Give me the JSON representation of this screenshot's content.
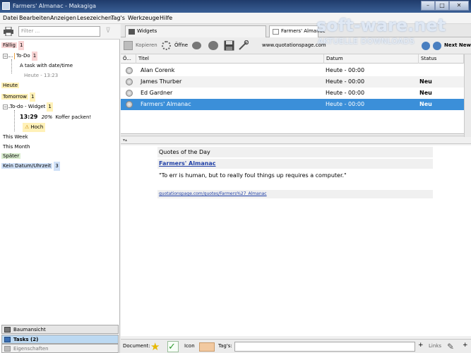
{
  "window": {
    "title": "Farmers' Almanac - Makagiga"
  },
  "menu": [
    "Datei",
    "Bearbeiten",
    "Anzeigen",
    "Lesezeichen",
    "Tag's",
    "Werkzeuge",
    "Hilfe"
  ],
  "watermark": {
    "line1": "soft-ware.net",
    "line2": "AKTUELLE DOWNLOADS"
  },
  "left": {
    "filter_placeholder": "Filter ...",
    "tree": {
      "faellig": {
        "label": "Fällig",
        "count": "1"
      },
      "todo_group": {
        "label": "To-Do",
        "count": "1"
      },
      "todo_task": {
        "title": "A task with date/time",
        "due": "Heute - 13:23"
      },
      "heute": {
        "label": "Heute"
      },
      "tomorrow": {
        "label": "Tomorrow",
        "count": "1"
      },
      "widget_group": {
        "label": "To-do - Widget",
        "count": "1"
      },
      "widget_task": {
        "time": "13:29",
        "percent": "20%",
        "title": "Koffer packen!",
        "priority": "Hoch"
      },
      "this_week": {
        "label": "This Week"
      },
      "this_month": {
        "label": "This Month"
      },
      "spaeter": {
        "label": "Später"
      },
      "kein_datum": {
        "label": "Kein Datum/Uhrzeit",
        "count": "3"
      }
    },
    "tabs": {
      "baumansicht": "Baumansicht",
      "tasks": "Tasks (2)",
      "eigenschaften": "Eigenschaften"
    }
  },
  "tabs": {
    "widgets": "Widgets",
    "farmers": "Farmers' Almanac"
  },
  "toolbar": {
    "kopieren": "Kopieren",
    "oeffne": "Öffne",
    "url": "www.quotationspage.com",
    "next_new": "Next New"
  },
  "table": {
    "columns": {
      "icon": "Ö...",
      "titel": "Titel",
      "datum": "Datum",
      "status": "Status"
    },
    "rows": [
      {
        "titel": "Alan Corenk",
        "datum": "Heute - 00:00",
        "status": ""
      },
      {
        "titel": "James Thurber",
        "datum": "Heute - 00:00",
        "status": "Neu"
      },
      {
        "titel": "Ed Gardner",
        "datum": "Heute - 00:00",
        "status": "Neu"
      },
      {
        "titel": "Farmers' Almanac",
        "datum": "Heute - 00:00",
        "status": "Neu"
      }
    ],
    "selected_row": 3
  },
  "preview": {
    "heading": "Quotes of the Day",
    "link": "Farmers' Almanac",
    "quote": "\"To err is human, but to really foul things up requires a computer.\"",
    "source": "quotationspage.com/quotes/Farmers%27_Almanac"
  },
  "bottombar": {
    "document": "Document:",
    "icon": "Icon",
    "tags": "Tag's:",
    "links": "Links"
  },
  "colors": {
    "selection": "#3b8fd9",
    "link": "#1f3fa6",
    "titlebar": "#2b4a80"
  }
}
